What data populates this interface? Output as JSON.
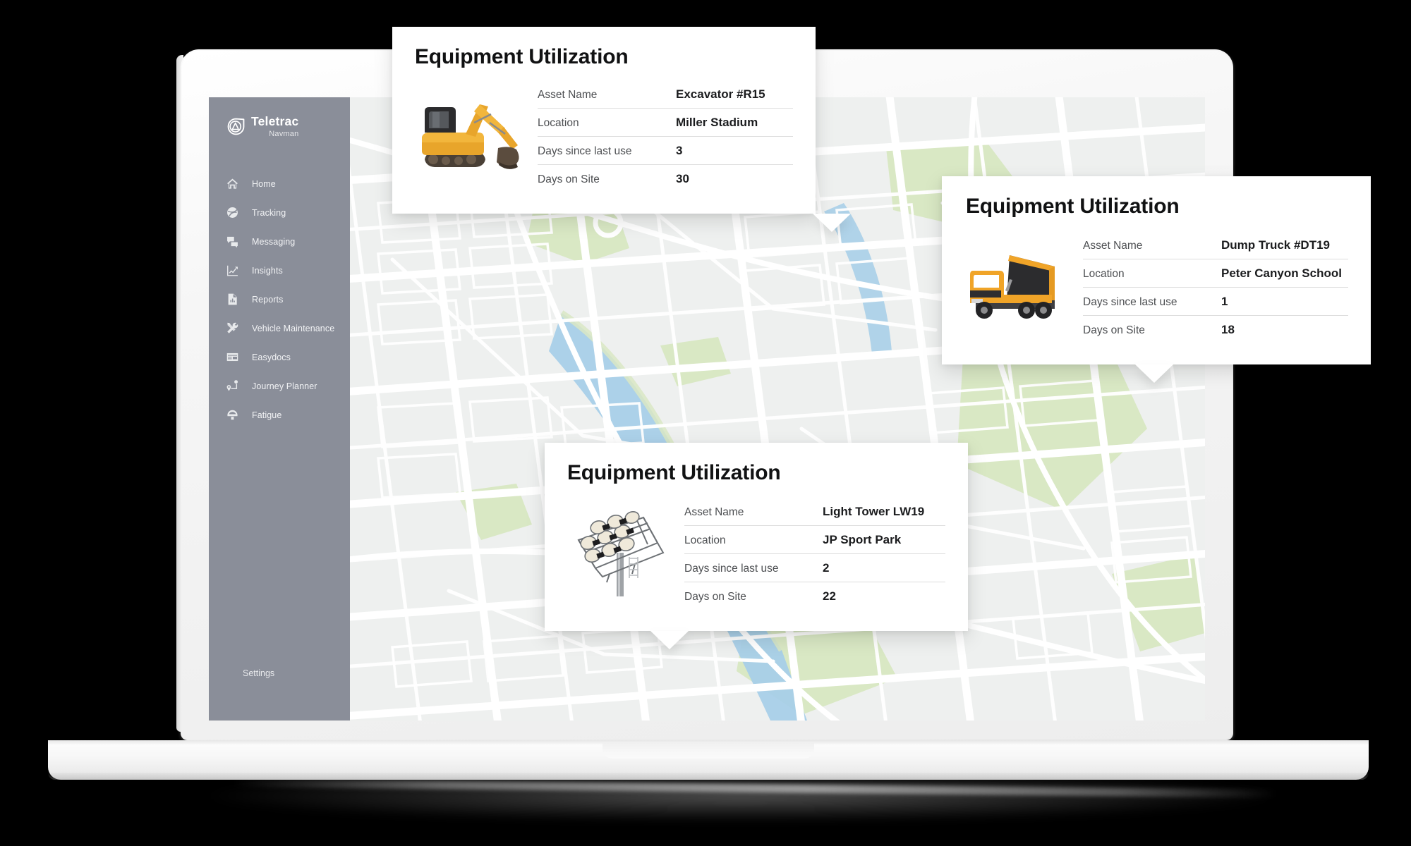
{
  "sidebar": {
    "brand": {
      "name": "Teletrac",
      "sub": "Navman",
      "logo_icon": "teletrac-shield-icon"
    },
    "items": [
      {
        "label": "Home",
        "icon": "home-icon"
      },
      {
        "label": "Tracking",
        "icon": "globe-tracking-icon"
      },
      {
        "label": "Messaging",
        "icon": "chat-bubbles-icon"
      },
      {
        "label": "Insights",
        "icon": "line-chart-icon"
      },
      {
        "label": "Reports",
        "icon": "document-bar-chart-icon"
      },
      {
        "label": "Vehicle Maintenance",
        "icon": "wrench-screwdriver-icon"
      },
      {
        "label": "Easydocs",
        "icon": "table-card-icon"
      },
      {
        "label": "Journey Planner",
        "icon": "route-pin-icon"
      },
      {
        "label": "Fatigue",
        "icon": "steering-wheel-icon"
      }
    ],
    "settings_label": "Settings"
  },
  "cards": [
    {
      "title": "Equipment Utilization",
      "thumb_icon": "excavator-photo",
      "rows": [
        {
          "label": "Asset Name",
          "value": "Excavator #R15"
        },
        {
          "label": "Location",
          "value": "Miller Stadium"
        },
        {
          "label": "Days since last use",
          "value": "3"
        },
        {
          "label": "Days on Site",
          "value": "30"
        }
      ]
    },
    {
      "title": "Equipment Utilization",
      "thumb_icon": "dump-truck-photo",
      "rows": [
        {
          "label": "Asset Name",
          "value": "Dump Truck #DT19"
        },
        {
          "label": "Location",
          "value": "Peter Canyon School"
        },
        {
          "label": "Days since last use",
          "value": "1"
        },
        {
          "label": "Days on Site",
          "value": "18"
        }
      ]
    },
    {
      "title": "Equipment Utilization",
      "thumb_icon": "light-tower-photo",
      "rows": [
        {
          "label": "Asset Name",
          "value": "Light Tower LW19"
        },
        {
          "label": "Location",
          "value": "JP Sport Park"
        },
        {
          "label": "Days since last use",
          "value": "2"
        },
        {
          "label": "Days on Site",
          "value": "22"
        }
      ]
    }
  ],
  "colors": {
    "sidebar_bg": "#8a8e99",
    "map_bg": "#eef0ef",
    "map_road": "#ffffff",
    "map_park": "#d9e8c4",
    "map_water": "#a8cfe8",
    "card_bg": "#ffffff",
    "text_dark": "#1b1c1e",
    "text_muted": "#4d4f52",
    "laptop_body": "#f4f4f4"
  }
}
